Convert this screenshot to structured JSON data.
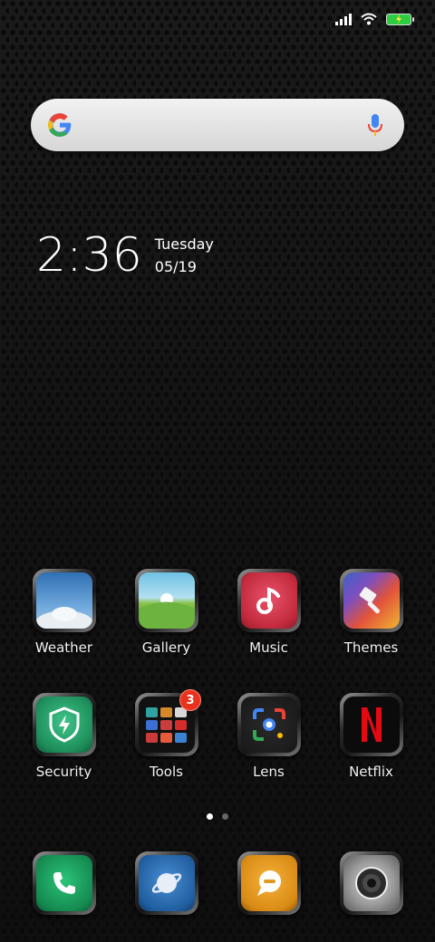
{
  "status_bar": {
    "icons": [
      "signal-icon",
      "wifi-icon",
      "battery-charging-icon"
    ],
    "battery_color": "#2ecc40"
  },
  "search": {
    "logo": "google-g-icon",
    "mic": "microphone-icon"
  },
  "clock": {
    "time": "2:36",
    "day": "Tuesday",
    "date": "05/19"
  },
  "apps": [
    {
      "label": "Weather",
      "icon": "weather-icon"
    },
    {
      "label": "Gallery",
      "icon": "gallery-icon"
    },
    {
      "label": "Music",
      "icon": "music-note-icon"
    },
    {
      "label": "Themes",
      "icon": "paintbrush-icon"
    },
    {
      "label": "Security",
      "icon": "shield-bolt-icon"
    },
    {
      "label": "Tools",
      "icon": "folder-icon",
      "badge": "3"
    },
    {
      "label": "Lens",
      "icon": "lens-icon"
    },
    {
      "label": "Netflix",
      "icon": "netflix-icon"
    }
  ],
  "page_indicator": {
    "total": 2,
    "active": 1
  },
  "dock": [
    {
      "icon": "phone-icon"
    },
    {
      "icon": "browser-icon"
    },
    {
      "icon": "messages-icon"
    },
    {
      "icon": "camera-icon"
    }
  ]
}
